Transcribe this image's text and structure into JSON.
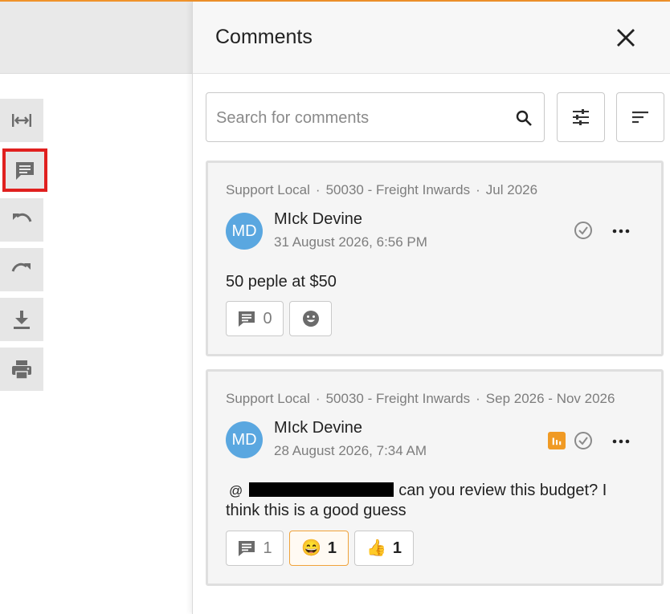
{
  "panel": {
    "title": "Comments",
    "search_placeholder": "Search for comments"
  },
  "toolbar": {
    "items": [
      {
        "icon": "fit-width-icon"
      },
      {
        "icon": "comment-icon",
        "active": true
      },
      {
        "icon": "undo-icon"
      },
      {
        "icon": "redo-icon"
      },
      {
        "icon": "download-icon"
      },
      {
        "icon": "print-icon"
      }
    ]
  },
  "comments": [
    {
      "meta_location": "Support Local",
      "meta_account": "50030 - Freight Inwards",
      "meta_period": "Jul 2026",
      "avatar": "MD",
      "author": "MIck Devine",
      "date": "31 August 2026, 6:56 PM",
      "text": "50 peple at $50",
      "reply_count": "0"
    },
    {
      "meta_location": "Support Local",
      "meta_account": "50030 - Freight Inwards",
      "meta_period": "Sep 2026 - Nov 2026",
      "avatar": "MD",
      "author": "MIck Devine",
      "date": "28 August 2026, 7:34 AM",
      "mention_prefix": "@",
      "text": "can you review this budget? I think this is a good guess",
      "reply_count": "1",
      "reactions": [
        {
          "emoji": "😄",
          "count": "1"
        },
        {
          "emoji": "👍",
          "count": "1"
        }
      ]
    }
  ],
  "colors": {
    "accent": "#f0922b",
    "avatar": "#5aa7e0",
    "highlight_box": "#e0201f"
  }
}
